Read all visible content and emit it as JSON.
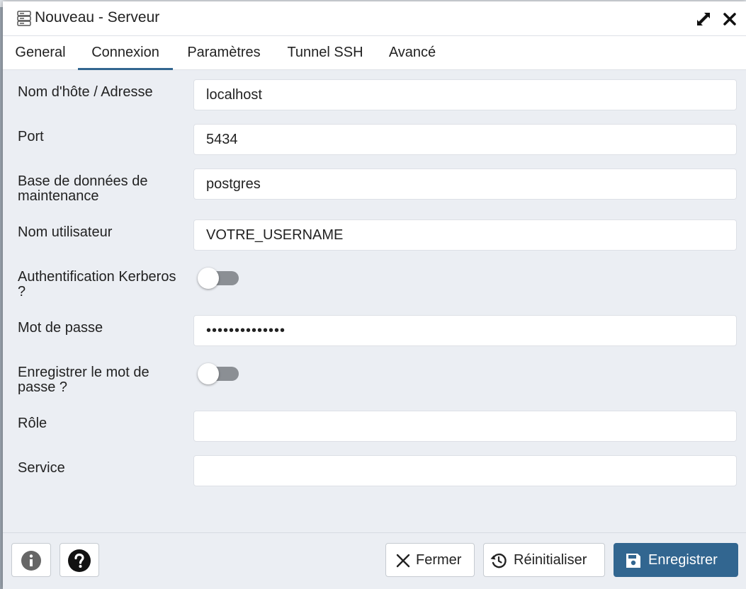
{
  "dialog": {
    "title": "Nouveau - Serveur",
    "expand_icon": "expand-icon",
    "close_icon": "close-icon"
  },
  "tabs": [
    {
      "label": "General",
      "active": false
    },
    {
      "label": "Connexion",
      "active": true
    },
    {
      "label": "Paramètres",
      "active": false
    },
    {
      "label": "Tunnel SSH",
      "active": false
    },
    {
      "label": "Avancé",
      "active": false
    }
  ],
  "form": {
    "host": {
      "label": "Nom d'hôte / Adresse",
      "value": "localhost"
    },
    "port": {
      "label": "Port",
      "value": "5434"
    },
    "maintenance_db": {
      "label": "Base de données de maintenance",
      "value": "postgres"
    },
    "username": {
      "label": "Nom utilisateur",
      "value": "VOTRE_USERNAME"
    },
    "kerberos": {
      "label": "Authentification Kerberos ?",
      "enabled": false
    },
    "password": {
      "label": "Mot de passe",
      "value": "••••••••••••••"
    },
    "save_password": {
      "label": "Enregistrer le mot de passe ?",
      "enabled": false
    },
    "role": {
      "label": "Rôle",
      "value": ""
    },
    "service": {
      "label": "Service",
      "value": ""
    }
  },
  "footer": {
    "info_icon": "info-icon",
    "help_icon": "help-icon",
    "close_label": "Fermer",
    "reset_label": "Réinitialiser",
    "save_label": "Enregistrer"
  },
  "colors": {
    "accent": "#326690",
    "background": "#ebeef3",
    "toggle_off": "#8b8f94"
  }
}
